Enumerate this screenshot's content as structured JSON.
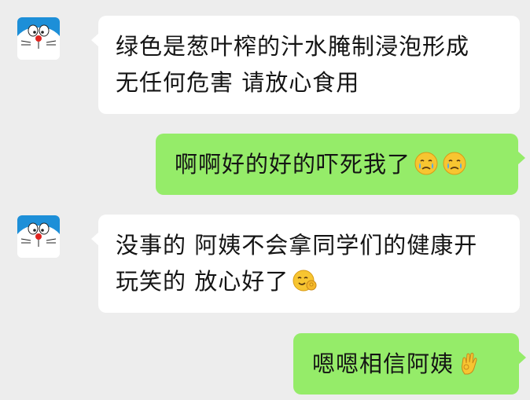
{
  "messages": [
    {
      "side": "left",
      "sender_avatar": "doraemon-avatar",
      "lines": [
        "绿色是葱叶榨的汁水腌制浸泡形成",
        "无任何危害 请放心食用"
      ]
    },
    {
      "side": "right",
      "text": "啊啊好的好的吓死我了",
      "emojis": [
        "tearful-face-emoji",
        "tearful-face-emoji"
      ]
    },
    {
      "side": "left",
      "sender_avatar": "doraemon-avatar",
      "lines": [
        "没事的 阿姨不会拿同学们的健康开",
        "玩笑的 放心好了"
      ],
      "emojis": [
        "ok-hand-smile-emoji"
      ]
    },
    {
      "side": "right",
      "text": "嗯嗯相信阿姨",
      "emojis": [
        "ok-hand-emoji"
      ]
    }
  ],
  "colors": {
    "background": "#ededed",
    "incoming_bubble": "#ffffff",
    "outgoing_bubble": "#95ec69",
    "text": "#141414"
  }
}
